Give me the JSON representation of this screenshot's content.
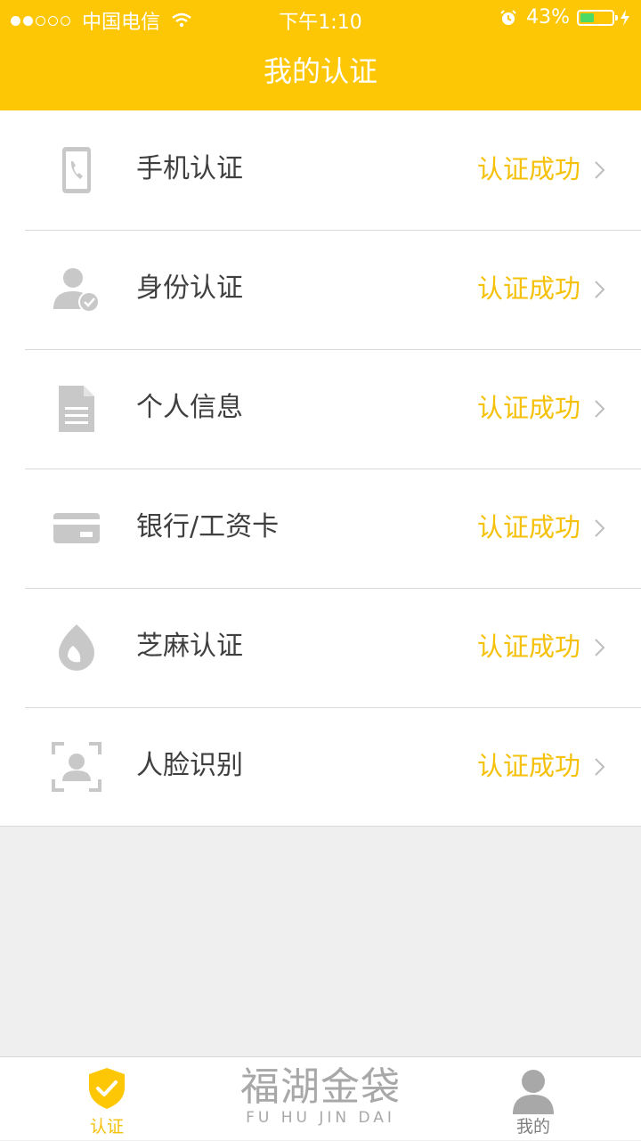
{
  "status_bar": {
    "carrier": "中国电信",
    "time": "下午1:10",
    "battery_percent": "43%",
    "battery_level": 0.43,
    "battery_color": "#4cd964"
  },
  "nav": {
    "title": "我的认证"
  },
  "items": [
    {
      "icon": "phone-icon",
      "label": "手机认证",
      "status": "认证成功"
    },
    {
      "icon": "user-check-icon",
      "label": "身份认证",
      "status": "认证成功"
    },
    {
      "icon": "document-icon",
      "label": "个人信息",
      "status": "认证成功"
    },
    {
      "icon": "card-icon",
      "label": "银行/工资卡",
      "status": "认证成功"
    },
    {
      "icon": "sesame-icon",
      "label": "芝麻认证",
      "status": "认证成功"
    },
    {
      "icon": "face-scan-icon",
      "label": "人脸识别",
      "status": "认证成功"
    }
  ],
  "tab_bar": {
    "tabs": [
      {
        "icon": "shield-check-icon",
        "label": "认证",
        "active": true
      },
      {
        "icon": "person-icon",
        "label": "我的",
        "active": false
      }
    ],
    "brand_cn": "福湖金袋",
    "brand_en": "FU HU JIN DAI"
  },
  "colors": {
    "accent": "#fec705",
    "status_text": "#f5c10a",
    "icon_gray": "#c8c8c8",
    "tab_inactive": "#999999"
  }
}
